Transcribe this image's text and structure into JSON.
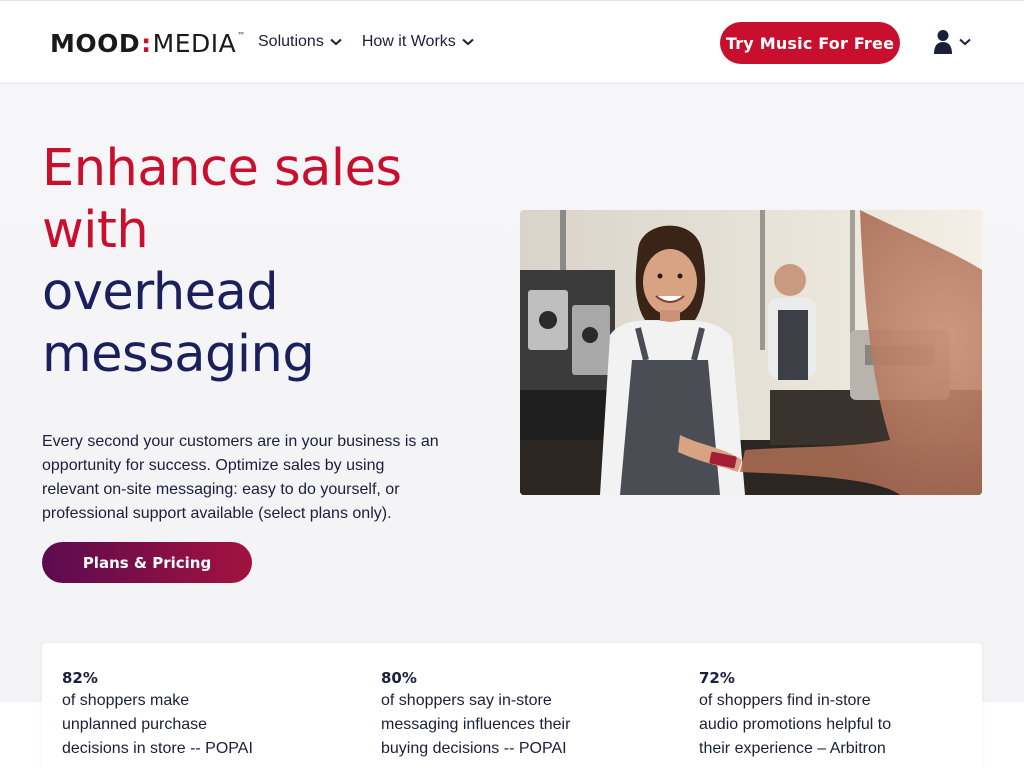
{
  "brand": {
    "logo_mood": "MOOD",
    "logo_colon": ":",
    "logo_media": "MEDIA",
    "logo_tm": "™",
    "accent": "#c8102e",
    "navy": "#1b1f5b"
  },
  "nav": {
    "items": [
      {
        "label": "Solutions",
        "icon": "chevron-down-icon"
      },
      {
        "label": "How it Works",
        "icon": "chevron-down-icon"
      }
    ],
    "cta_label": "Try Music For Free",
    "account_icon": "user-icon"
  },
  "hero": {
    "headline_red_1": "Enhance sales",
    "headline_red_2": "with",
    "headline_navy_1": "overhead",
    "headline_navy_2": "messaging",
    "intro": "Every second your customers are in your business is an opportunity for success. Optimize sales by using relevant on-site messaging: easy to do yourself, or professional support available (select plans only).",
    "button_label": "Plans & Pricing"
  },
  "stats": [
    {
      "value": "82%",
      "text": "of shoppers make unplanned purchase decisions in store -- POPAI"
    },
    {
      "value": "80%",
      "text": "of shoppers say in-store messaging influences their buying decisions -- POPAI"
    },
    {
      "value": "72%",
      "text": "of shoppers find in-store audio promotions helpful to their experience – Arbitron"
    }
  ]
}
